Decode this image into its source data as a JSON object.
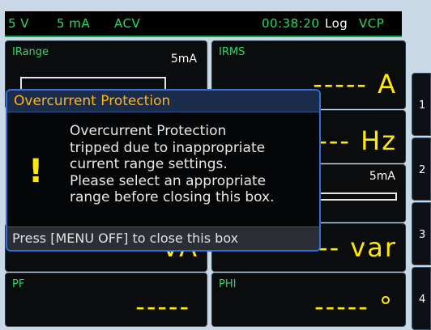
{
  "status": {
    "voltage": "5 V",
    "current": "5 mA",
    "mode": "ACV",
    "time": "00:38:20",
    "log": "Log",
    "vcp": "VCP"
  },
  "tiles": {
    "irange": {
      "label": "IRange",
      "value": "5mA"
    },
    "irms": {
      "label": "IRMS",
      "value": "----- A"
    },
    "freq": {
      "value": "--- Hz",
      "small": "5mA"
    },
    "s_power": {
      "value": "VA"
    },
    "q_power": {
      "value": "-- var"
    },
    "pf": {
      "label": "PF",
      "value": "-----"
    },
    "phi": {
      "label": "PHI",
      "value": "----- °"
    }
  },
  "softkeys": [
    "1",
    "2",
    "3",
    "4"
  ],
  "dialog": {
    "title": "Overcurrent Protection",
    "icon": "!",
    "lines": [
      "Overcurrent Protection",
      "tripped due to inappropriate",
      "current range settings.",
      "Please select an appropriate",
      "range before closing this box."
    ],
    "footer": "Press [MENU OFF] to close this box"
  },
  "colors": {
    "status_green": "#2bd96a",
    "value_yellow": "#ffea00",
    "dialog_border": "#2f6fd6",
    "dialog_title": "#ffb31a"
  }
}
